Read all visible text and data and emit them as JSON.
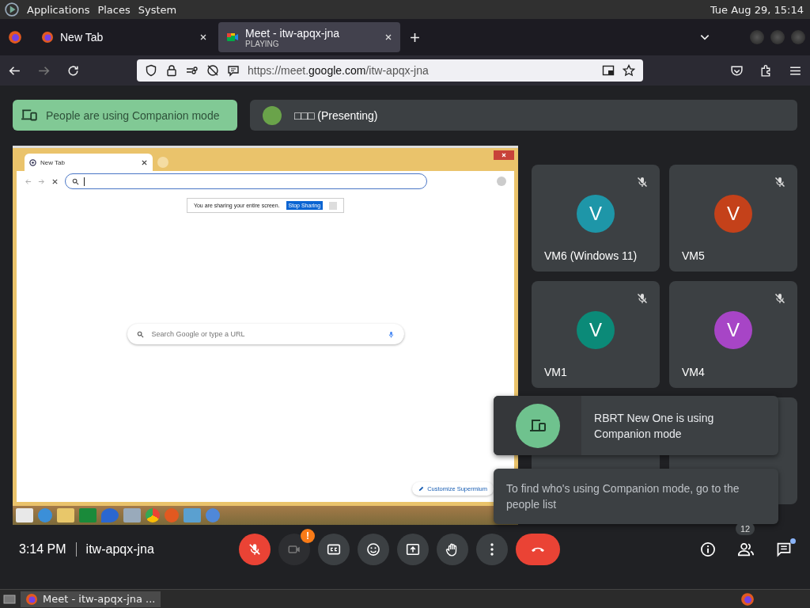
{
  "top_bar": {
    "menus": [
      "Applications",
      "Places",
      "System"
    ],
    "clock": "Tue Aug 29, 15:14"
  },
  "browser": {
    "tabs": [
      {
        "title": "New Tab",
        "selected": false
      },
      {
        "title": "Meet - itw-apqx-jna",
        "status": "PLAYING",
        "selected": true
      }
    ],
    "url": "https://meet.**google.com**/itw-apqx-jna"
  },
  "meet": {
    "companion_banner": "People are using Companion mode",
    "presenter": "□□□ (Presenting)",
    "shared_screen": {
      "tab_title": "New Tab",
      "sharing_notice": "You are sharing your entire screen.",
      "stop_button": "Stop Sharing",
      "search_placeholder": "Search Google or type a URL",
      "customize_button": "Customize Supermium"
    },
    "participants": [
      {
        "initial": "V",
        "name": "VM6 (Windows 11)",
        "color": "#1e96a8",
        "muted": true
      },
      {
        "initial": "V",
        "name": "VM5",
        "color": "#c4411a",
        "muted": true
      },
      {
        "initial": "V",
        "name": "VM1",
        "color": "#0b8a78",
        "muted": true
      },
      {
        "initial": "V",
        "name": "VM4",
        "color": "#a745c6",
        "muted": true
      }
    ],
    "notifications": [
      {
        "kind": "companion",
        "text": "RBRT New One is using Companion mode"
      },
      {
        "kind": "hint",
        "text": "To find who's using Companion mode, go to the people list"
      }
    ],
    "call_bar": {
      "time": "3:14 PM",
      "meeting_code": "itw-apqx-jna",
      "mic_on": false,
      "camera_on": false,
      "camera_alert": "!",
      "people_count": "12",
      "chat_unread": true
    }
  },
  "taskbar": {
    "window": "Meet - itw-apqx-jna ..."
  }
}
